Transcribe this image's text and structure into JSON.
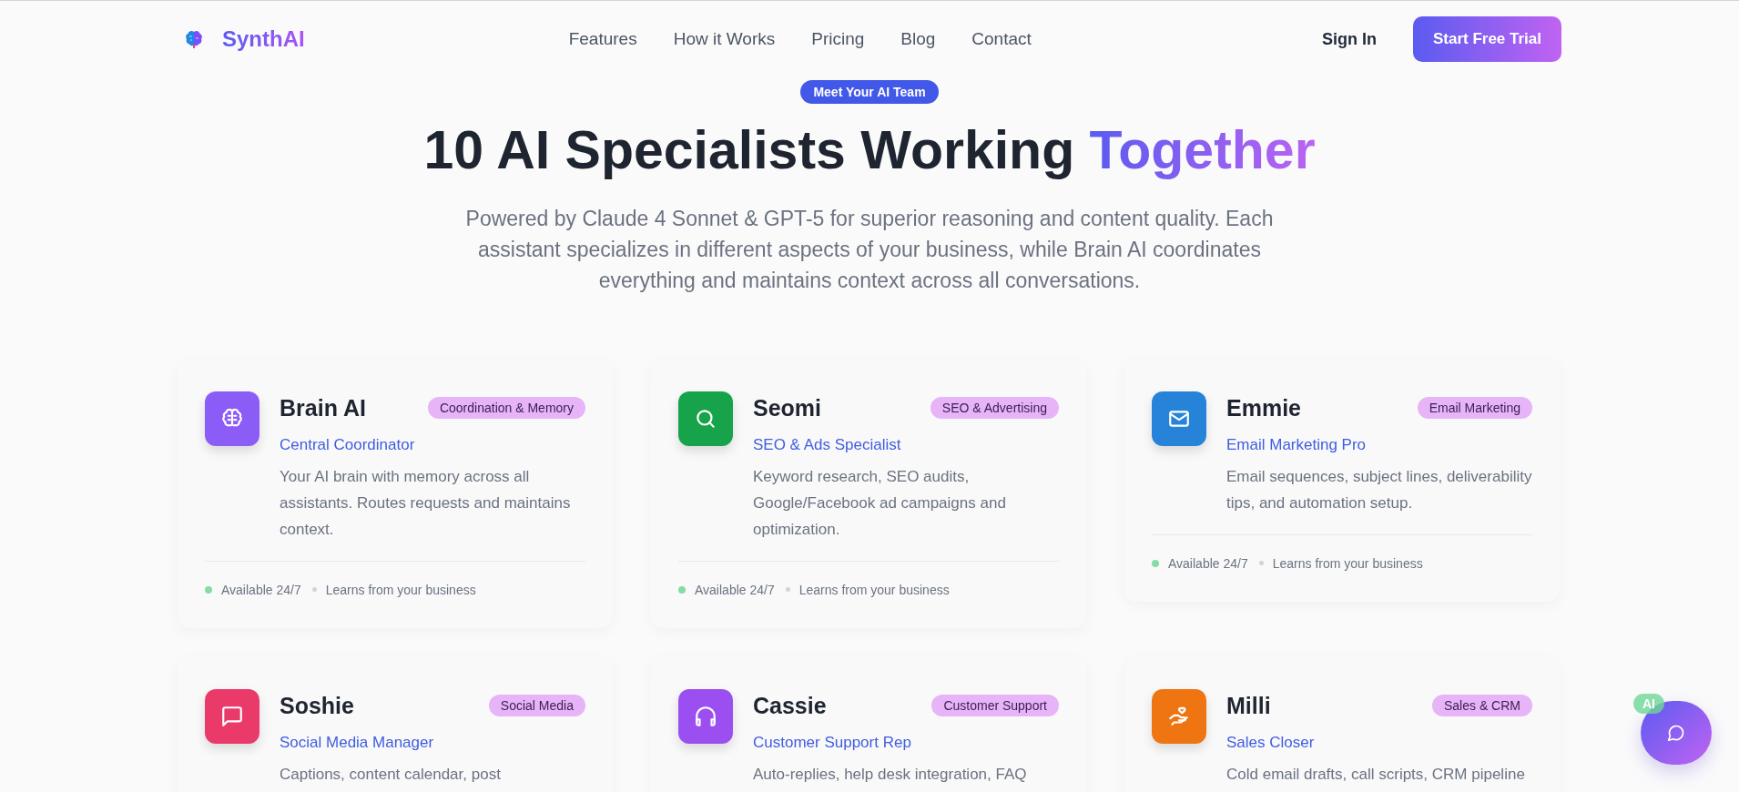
{
  "brand": {
    "name": "SynthAI"
  },
  "nav": [
    "Features",
    "How it Works",
    "Pricing",
    "Blog",
    "Contact"
  ],
  "actions": {
    "sign_in": "Sign In",
    "trial": "Start Free Trial"
  },
  "hero": {
    "badge": "Meet Your AI Team",
    "title": "10 AI Specialists Working",
    "title_highlight": "Together",
    "subtitle": "Powered by Claude 4 Sonnet & GPT-5 for superior reasoning and content quality. Each assistant specializes in different aspects of your business, while Brain AI coordinates everything and maintains context across all conversations."
  },
  "assistants": [
    {
      "kind": "brain",
      "color": "#8b5cf6",
      "name": "Brain AI",
      "tag": "Coordination & Memory",
      "role": "Central Coordinator",
      "description": "Your AI brain with memory across all assistants. Routes requests and maintains context.",
      "footer": [
        "Available 24/7",
        "Learns from your business"
      ]
    },
    {
      "kind": "search",
      "color": "#16a34a",
      "name": "Seomi",
      "tag": "SEO & Advertising",
      "role": "SEO & Ads Specialist",
      "description": "Keyword research, SEO audits, Google/Facebook ad campaigns and optimization.",
      "footer": [
        "Available 24/7",
        "Learns from your business"
      ]
    },
    {
      "kind": "mail",
      "color": "#2783d8",
      "name": "Emmie",
      "tag": "Email Marketing",
      "role": "Email Marketing Pro",
      "description": "Email sequences, subject lines, deliverability tips, and automation setup.",
      "footer": [
        "Available 24/7",
        "Learns from your business"
      ]
    },
    {
      "kind": "message",
      "color": "#e93a6a",
      "name": "Soshie",
      "tag": "Social Media",
      "role": "Social Media Manager",
      "description": "Captions, content calendar, post"
    },
    {
      "kind": "headphones",
      "color": "#9b4ff0",
      "name": "Cassie",
      "tag": "Customer Support",
      "role": "Customer Support Rep",
      "description": "Auto-replies, help desk integration, FAQ"
    },
    {
      "kind": "hand",
      "color": "#ef7512",
      "name": "Milli",
      "tag": "Sales & CRM",
      "role": "Sales Closer",
      "description": "Cold email drafts, call scripts, CRM pipeline"
    }
  ],
  "chat": {
    "badge": "AI"
  }
}
